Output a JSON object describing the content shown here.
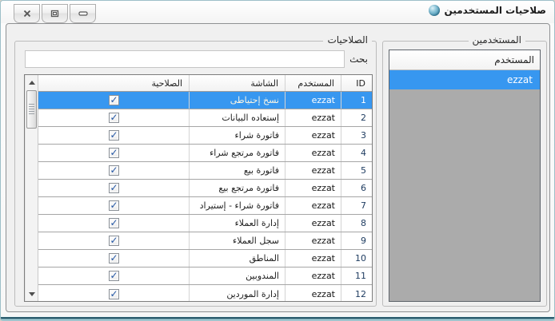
{
  "window": {
    "title": "صلاحيات المستخدمين",
    "title_icon": "app-sphere-icon",
    "controls": [
      {
        "name": "close",
        "icon": "close-icon"
      },
      {
        "name": "maximize",
        "icon": "maximize-icon"
      },
      {
        "name": "minimize",
        "icon": "minimize-icon"
      }
    ]
  },
  "users_panel": {
    "legend": "المستخدمين",
    "list_header": "المستخدم",
    "selected_user": "ezzat"
  },
  "permissions_panel": {
    "legend": "الصلاحيات",
    "search_label": "بحث",
    "search_value": "",
    "table": {
      "columns": [
        "ID",
        "المستخدم",
        "الشاشة",
        "الصلاحية"
      ],
      "rows": [
        {
          "id": "1",
          "user": "ezzat",
          "screen": "نسخ إحتياطى",
          "allowed": true,
          "selected": true
        },
        {
          "id": "2",
          "user": "ezzat",
          "screen": "إستعاده البيانات",
          "allowed": true,
          "selected": false
        },
        {
          "id": "3",
          "user": "ezzat",
          "screen": "فاتورة شراء",
          "allowed": true,
          "selected": false
        },
        {
          "id": "4",
          "user": "ezzat",
          "screen": "فاتورة مرتجع شراء",
          "allowed": true,
          "selected": false
        },
        {
          "id": "5",
          "user": "ezzat",
          "screen": "فاتورة بيع",
          "allowed": true,
          "selected": false
        },
        {
          "id": "6",
          "user": "ezzat",
          "screen": "فاتورة مرتجع بيع",
          "allowed": true,
          "selected": false
        },
        {
          "id": "7",
          "user": "ezzat",
          "screen": "فاتورة شراء - إستيراد",
          "allowed": true,
          "selected": false
        },
        {
          "id": "8",
          "user": "ezzat",
          "screen": "إدارة العملاء",
          "allowed": true,
          "selected": false
        },
        {
          "id": "9",
          "user": "ezzat",
          "screen": "سجل العملاء",
          "allowed": true,
          "selected": false
        },
        {
          "id": "10",
          "user": "ezzat",
          "screen": "المناطق",
          "allowed": true,
          "selected": false
        },
        {
          "id": "11",
          "user": "ezzat",
          "screen": "المندوبين",
          "allowed": true,
          "selected": false
        },
        {
          "id": "12",
          "user": "ezzat",
          "screen": "إدارة الموردين",
          "allowed": true,
          "selected": false
        }
      ]
    }
  },
  "colors": {
    "selection_blue": "#3797f0",
    "list_gray": "#ababab",
    "panel_bg": "#f0f0f0",
    "window_edge_teal": "#2c5d6e"
  }
}
